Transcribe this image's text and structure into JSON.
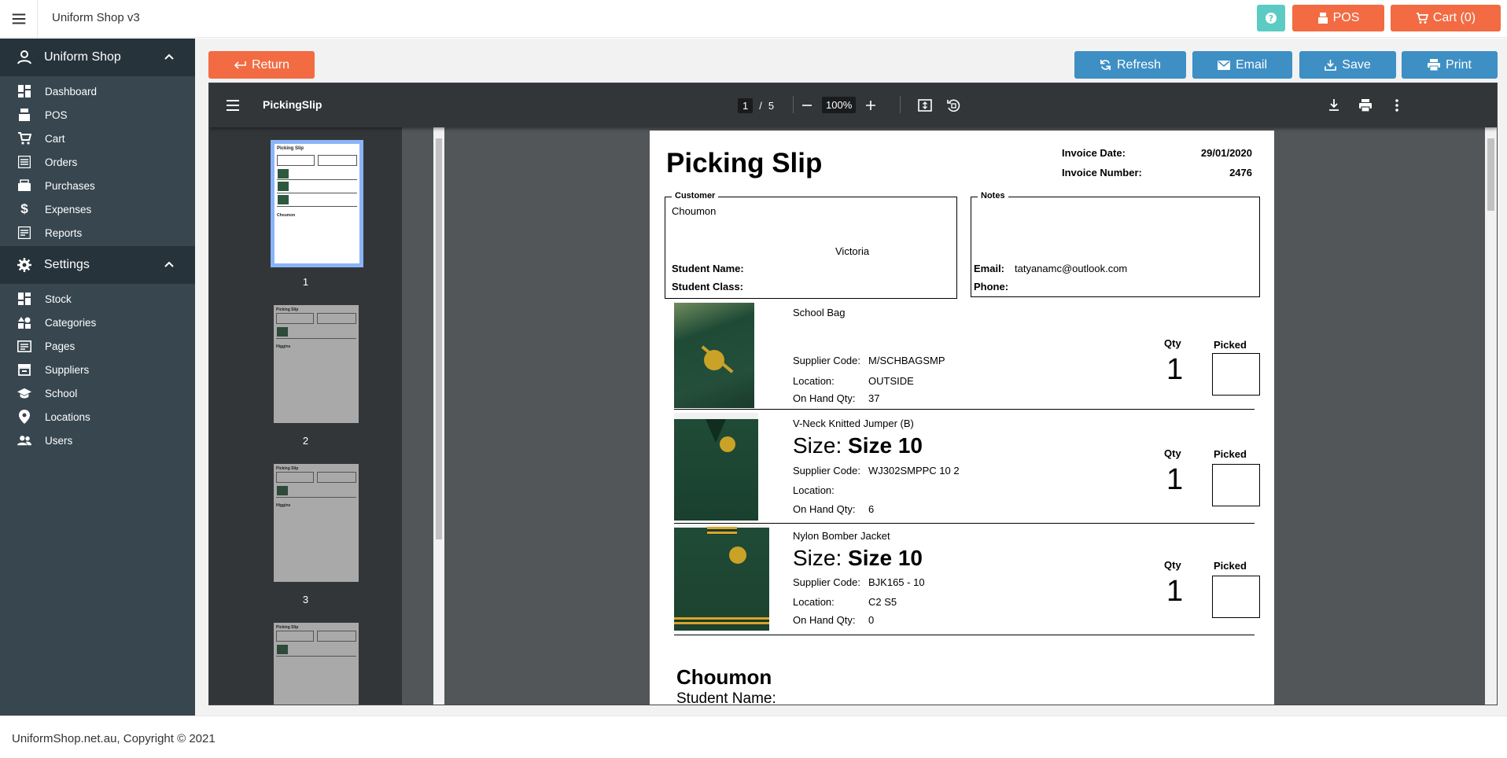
{
  "app": {
    "title": "Uniform Shop v3"
  },
  "topbar": {
    "help_label": "?",
    "pos_label": "POS",
    "cart_label": "Cart (0)"
  },
  "sidebar": {
    "group1": {
      "label": "Uniform Shop"
    },
    "items1": [
      {
        "label": "Dashboard",
        "icon": "dashboard-icon"
      },
      {
        "label": "POS",
        "icon": "pos-icon"
      },
      {
        "label": "Cart",
        "icon": "cart-icon"
      },
      {
        "label": "Orders",
        "icon": "orders-icon"
      },
      {
        "label": "Purchases",
        "icon": "purchases-icon"
      },
      {
        "label": "Expenses",
        "icon": "dollar-icon"
      },
      {
        "label": "Reports",
        "icon": "reports-icon"
      }
    ],
    "group2": {
      "label": "Settings"
    },
    "items2": [
      {
        "label": "Stock",
        "icon": "stock-icon"
      },
      {
        "label": "Categories",
        "icon": "categories-icon"
      },
      {
        "label": "Pages",
        "icon": "pages-icon"
      },
      {
        "label": "Suppliers",
        "icon": "suppliers-icon"
      },
      {
        "label": "School",
        "icon": "school-icon"
      },
      {
        "label": "Locations",
        "icon": "location-icon"
      },
      {
        "label": "Users",
        "icon": "users-icon"
      }
    ]
  },
  "actions": {
    "return_label": "Return",
    "refresh_label": "Refresh",
    "email_label": "Email",
    "save_label": "Save",
    "print_label": "Print"
  },
  "pdf": {
    "filename": "PickingSlip",
    "current_page": "1",
    "page_separator": "/",
    "total_pages": "5",
    "zoom": "100%",
    "thumbnails": [
      "1",
      "2",
      "3"
    ]
  },
  "document": {
    "title": "Picking Slip",
    "invoice_date_label": "Invoice Date:",
    "invoice_date": "29/01/2020",
    "invoice_number_label": "Invoice Number:",
    "invoice_number": "2476",
    "customer_legend": "Customer",
    "customer_name": "Choumon",
    "customer_state": "Victoria",
    "student_name_label": "Student Name:",
    "student_class_label": "Student Class:",
    "notes_legend": "Notes",
    "email_label": "Email:",
    "email": "tatyanamc@outlook.com",
    "phone_label": "Phone:",
    "supplier_code_label": "Supplier Code:",
    "location_label": "Location:",
    "on_hand_label": "On Hand Qty:",
    "qty_label": "Qty",
    "picked_label": "Picked",
    "size_prefix": "Size:",
    "items": [
      {
        "name": "School Bag",
        "size": "",
        "supplier_code": "M/SCHBAGSMP",
        "location": "OUTSIDE",
        "on_hand": "37",
        "qty": "1"
      },
      {
        "name": "V-Neck  Knitted Jumper (B)",
        "size": "Size 10",
        "supplier_code": "WJ302SMPPC 10 2",
        "location": "",
        "on_hand": "6",
        "qty": "1"
      },
      {
        "name": "Nylon Bomber Jacket",
        "size": "Size 10",
        "supplier_code": "BJK165 - 10",
        "location": "C2 S5",
        "on_hand": "0",
        "qty": "1"
      }
    ],
    "page2_name": "Choumon",
    "page2_student_label": "Student Name:"
  },
  "footer": {
    "copyright": "UniformShop.net.au, Copyright © 2021"
  }
}
